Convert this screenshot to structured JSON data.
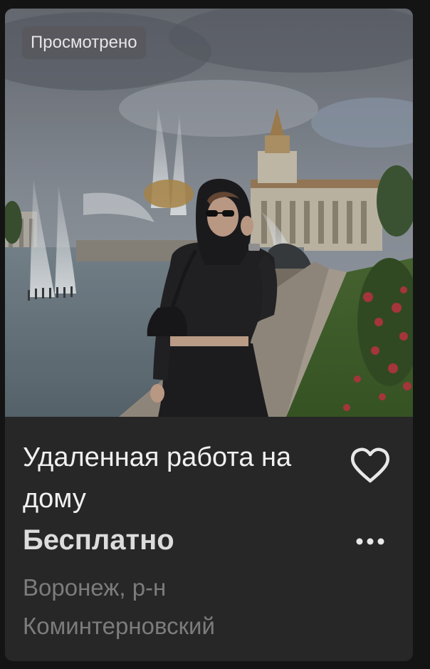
{
  "listing": {
    "viewed_badge": "Просмотрено",
    "title": "Удаленная работа на дому",
    "price": "Бесплатно",
    "location": "Воронеж, р-н Коминтерновский",
    "favorite_icon": "heart-outline-icon",
    "more_icon": "more-horizontal-icon"
  },
  "colors": {
    "background": "#141414",
    "card": "#272727",
    "title": "#f0f0f0",
    "price": "#dcdcdc",
    "location": "#7c7c7c",
    "badge": "#58585c"
  }
}
